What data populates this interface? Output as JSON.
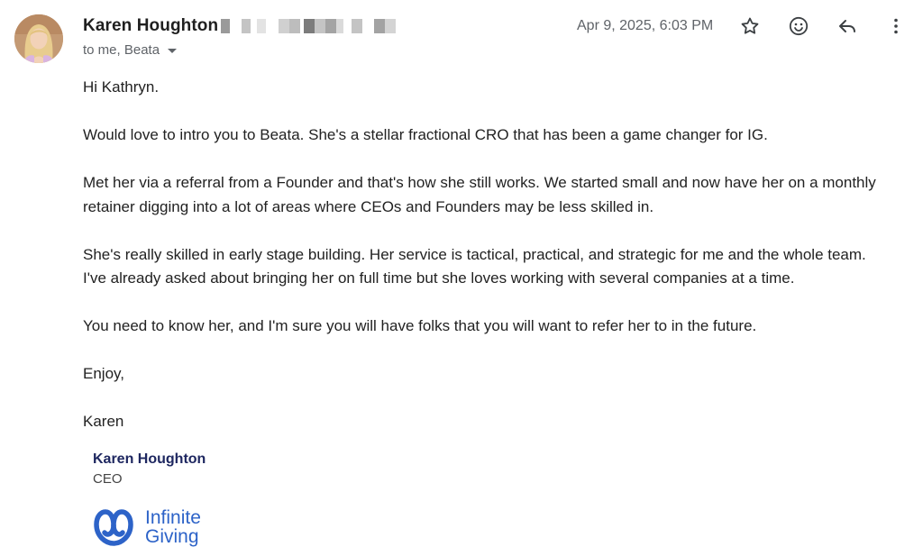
{
  "sender": {
    "name": "Karen Houghton",
    "recipients_line": "to me, Beata",
    "timestamp": "Apr 9, 2025, 6:03 PM"
  },
  "actions": {
    "star_icon": "star-icon",
    "emoji_icon": "smiley-icon",
    "reply_icon": "reply-icon",
    "more_icon": "more-vert-icon"
  },
  "message": {
    "greeting": "Hi Kathryn.",
    "paragraphs": [
      [
        "Would love to intro you to Beata. She's a stellar fractional CRO that has been a game changer for IG."
      ],
      [
        "Met her via a referral from a Founder and that's how she still works. We started small and now have her on a monthly",
        "retainer digging into a lot of areas where CEOs and Founders may be less skilled in."
      ],
      [
        "She's really skilled in early stage building. Her service is tactical, practical, and strategic for me and the whole team.",
        "I've already asked about bringing her on full time but she loves working with several companies at a time."
      ],
      [
        "You need to know her, and I'm sure you will have folks that you will want to refer her to in the future."
      ]
    ],
    "closing": "Enjoy,",
    "signoff": "Karen"
  },
  "signature": {
    "name": "Karen Houghton",
    "title": "CEO",
    "logo_line1": "Infinite",
    "logo_line2": "Giving",
    "brand_color": "#2d63c8"
  }
}
